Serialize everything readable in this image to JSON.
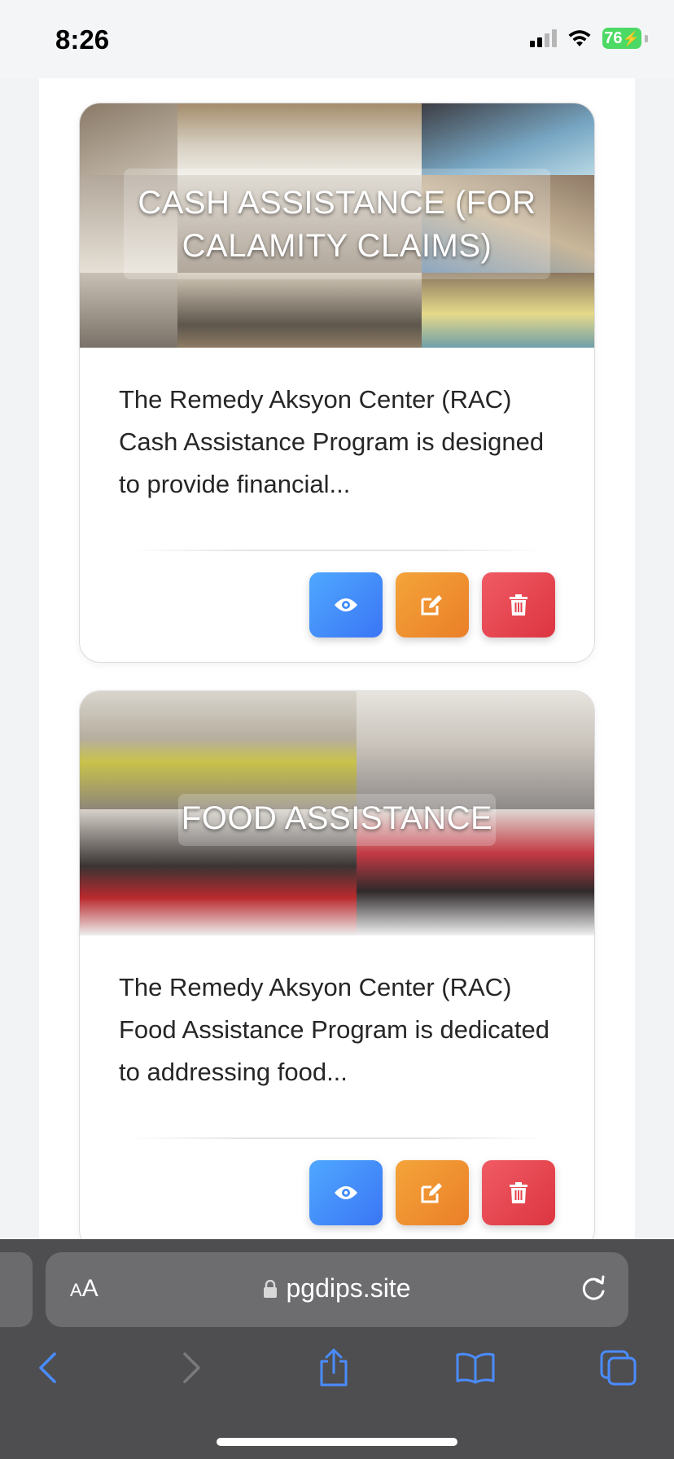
{
  "status_bar": {
    "time": "8:26",
    "battery_percent": "76",
    "signal_bars_active": 2,
    "signal_bars_total": 4,
    "charging": true
  },
  "cards": [
    {
      "title": "CASH ASSISTANCE (FOR CALAMITY CLAIMS)",
      "description": "The Remedy Aksyon Center (RAC) Cash Assistance Program is designed to provide financial..."
    },
    {
      "title": "FOOD ASSISTANCE",
      "description": "The Remedy Aksyon Center (RAC) Food Assistance Program is dedicated to addressing food..."
    }
  ],
  "actions": {
    "view_icon": "eye-icon",
    "edit_icon": "edit-icon",
    "delete_icon": "trash-icon",
    "view_color": "#3f8cfb",
    "edit_color": "#f0922f",
    "delete_color": "#e5434d"
  },
  "browser": {
    "text_size_label": "AA",
    "url": "pgdips.site",
    "toolbar_icons": [
      "back-icon",
      "forward-icon",
      "share-icon",
      "bookmarks-icon",
      "tabs-icon"
    ],
    "accent_color": "#4a8cff"
  }
}
